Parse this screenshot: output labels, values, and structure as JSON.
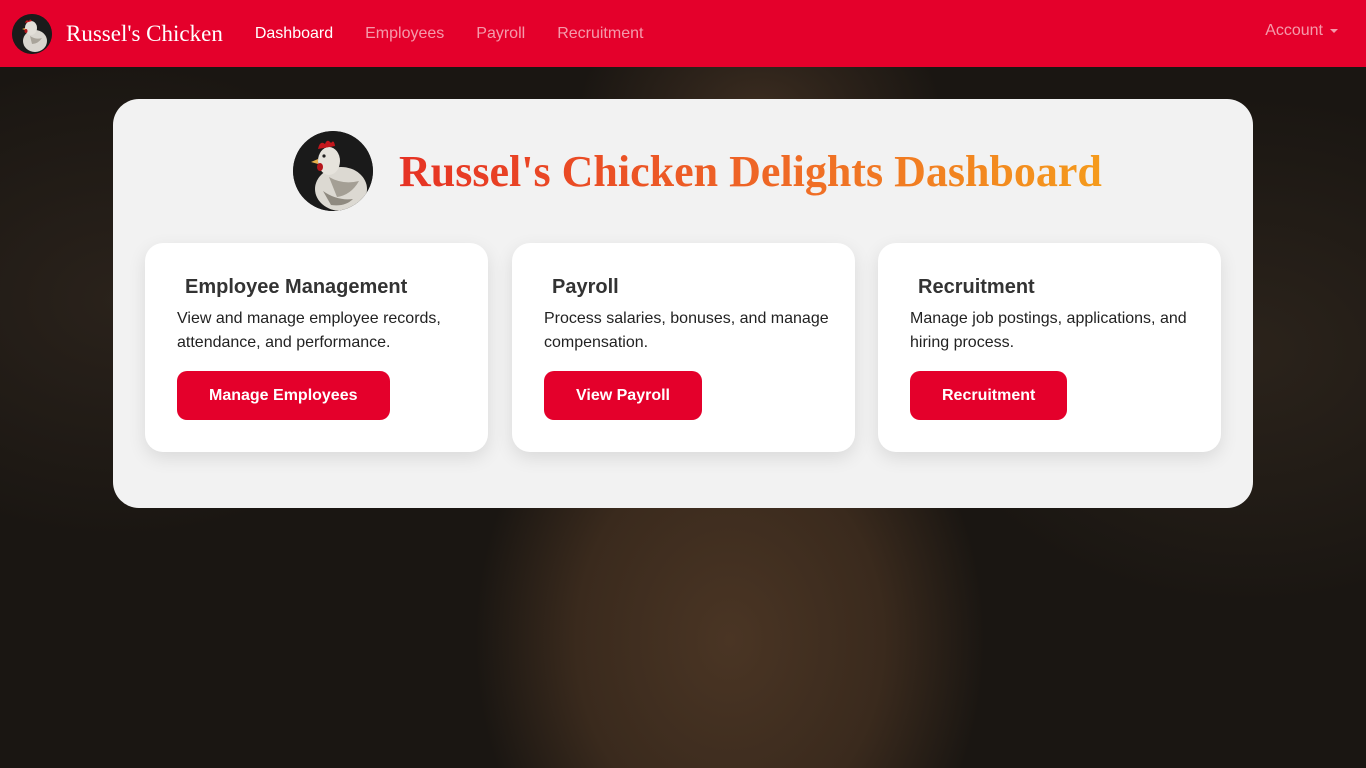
{
  "navbar": {
    "brand": "Russel's Chicken",
    "links": [
      {
        "label": "Dashboard",
        "active": true
      },
      {
        "label": "Employees",
        "active": false
      },
      {
        "label": "Payroll",
        "active": false
      },
      {
        "label": "Recruitment",
        "active": false
      }
    ],
    "account_label": "Account",
    "logo_icon": "rooster-logo-icon",
    "accent_color": "#e4002b"
  },
  "dashboard": {
    "title": "Russel's Chicken Delights Dashboard",
    "logo_icon": "rooster-logo-icon",
    "title_gradient": [
      "#e63224",
      "#f59b1c"
    ],
    "cards": [
      {
        "title": "Employee Management",
        "text": "View and manage employee records, attendance, and performance.",
        "button": "Manage Employees"
      },
      {
        "title": "Payroll",
        "text": "Process salaries, bonuses, and manage compensation.",
        "button": "View Payroll"
      },
      {
        "title": "Recruitment",
        "text": "Manage job postings, applications, and hiring process.",
        "button": "Recruitment"
      }
    ]
  }
}
